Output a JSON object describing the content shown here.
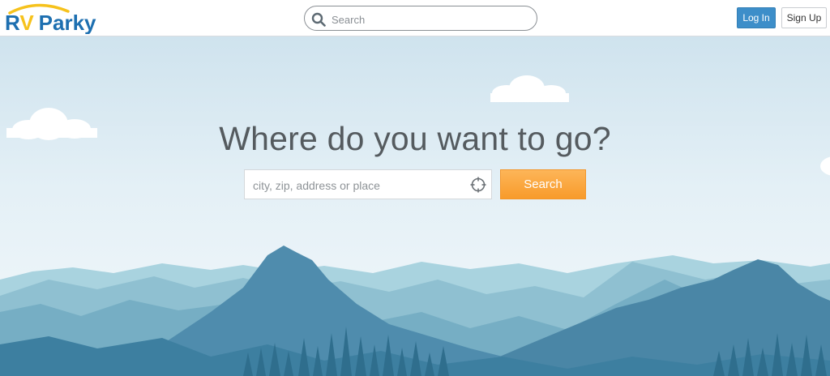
{
  "brand": {
    "name_prefix": "R",
    "name_v": "V",
    "name_suffix": "Parky",
    "primary_color": "#1d6fb0",
    "accent_color": "#f6c21c"
  },
  "header": {
    "search": {
      "placeholder": "Search",
      "value": ""
    },
    "login_label": "Log In",
    "signup_label": "Sign Up"
  },
  "hero": {
    "headline": "Where do you want to go?",
    "place_search": {
      "placeholder": "city, zip, address or place",
      "value": ""
    },
    "search_button_label": "Search"
  },
  "icons": {
    "header_search": "search-icon",
    "locate": "crosshair-locate-icon"
  },
  "colors": {
    "login_button": "#3d8ec9",
    "search_button": "#f89b2b",
    "sky_top": "#cfe3ee",
    "mountain_dark": "#3d7fa0",
    "mountain_light": "#a9d0dc"
  }
}
